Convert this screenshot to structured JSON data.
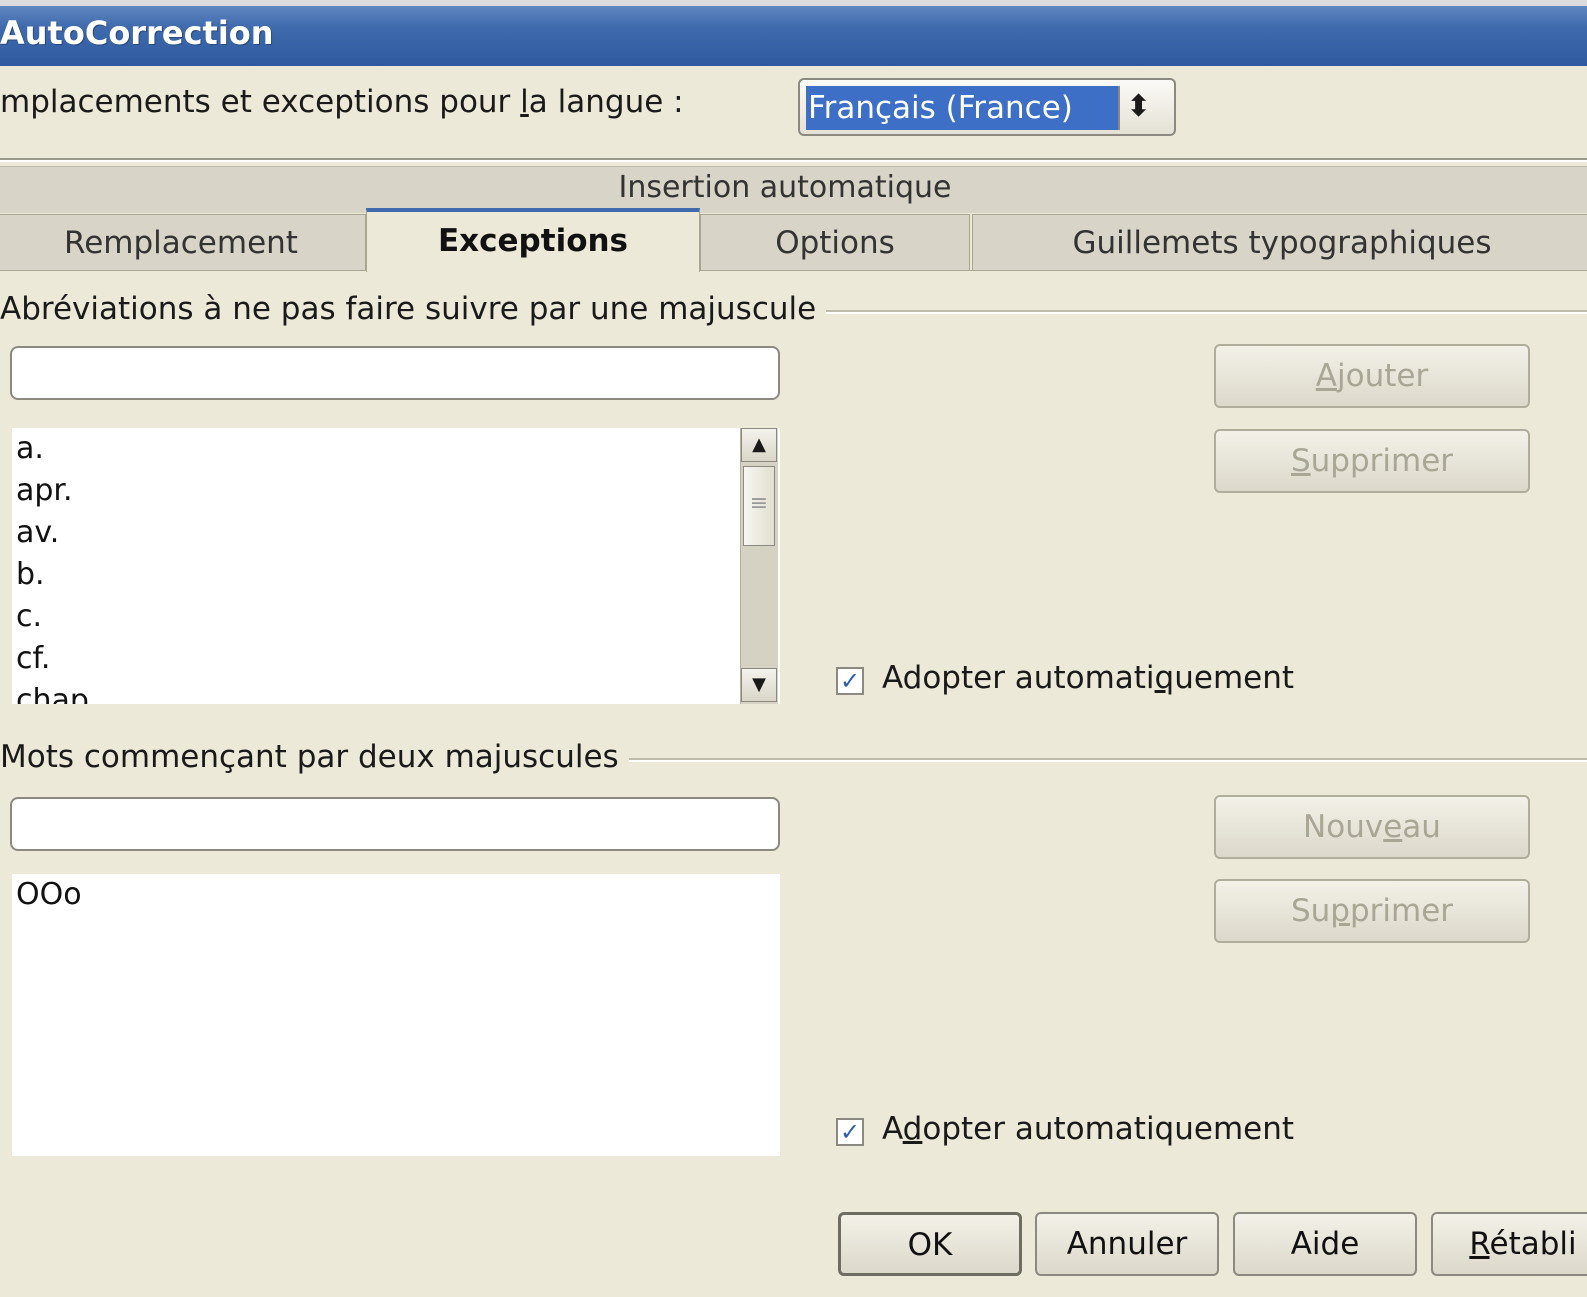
{
  "window": {
    "title": "AutoCorrection"
  },
  "language": {
    "label": "mplacements et exceptions pour la langue :",
    "label_pre": "mplacements et exceptions pour ",
    "label_accel": "l",
    "label_post": "a langue :",
    "selected": "Français (France)",
    "arrows_icon": "up-down-arrows-icon"
  },
  "group_title": "Insertion automatique",
  "tabs": [
    {
      "label": "Remplacement",
      "active": false
    },
    {
      "label": "Exceptions",
      "active": true
    },
    {
      "label": "Options",
      "active": false
    },
    {
      "label": "Guillemets typographiques",
      "active": false
    }
  ],
  "abbreviations": {
    "section_label": "Abréviations à ne pas faire suivre par une majuscule",
    "input_value": "",
    "items": [
      "a.",
      "apr.",
      "av.",
      "b.",
      "c.",
      "cf.",
      "chap."
    ],
    "add_button": {
      "label": "Ajouter",
      "accel": "A",
      "rest": "jouter",
      "enabled": false
    },
    "delete_button": {
      "label": "Supprimer",
      "accel": "S",
      "rest": "upprimer",
      "enabled": false
    },
    "auto_checkbox": {
      "label": "Adopter automatiquement",
      "pre": "Adopter automati",
      "accel": "q",
      "post": "uement",
      "checked": true
    }
  },
  "double_capitals": {
    "section_label": "Mots commençant par deux majuscules",
    "input_value": "",
    "items": [
      "OOo"
    ],
    "new_button": {
      "label": "Nouveau",
      "pre": "Nouv",
      "accel": "e",
      "post": "au",
      "enabled": false
    },
    "delete_button": {
      "label": "Supprimer",
      "pre": "Su",
      "accel": "p",
      "post": "primer",
      "enabled": false
    },
    "auto_checkbox": {
      "label": "Adopter automatiquement",
      "pre": "A",
      "accel": "d",
      "post": "opter automatiquement",
      "checked": true
    }
  },
  "footer": {
    "ok": "OK",
    "cancel": "Annuler",
    "help": "Aide",
    "reset_accel": "R",
    "reset_rest": "établi"
  },
  "colors": {
    "titlebar": "#3f6aad",
    "selection": "#3d6fc7",
    "dialog_bg": "#ece9d8"
  }
}
